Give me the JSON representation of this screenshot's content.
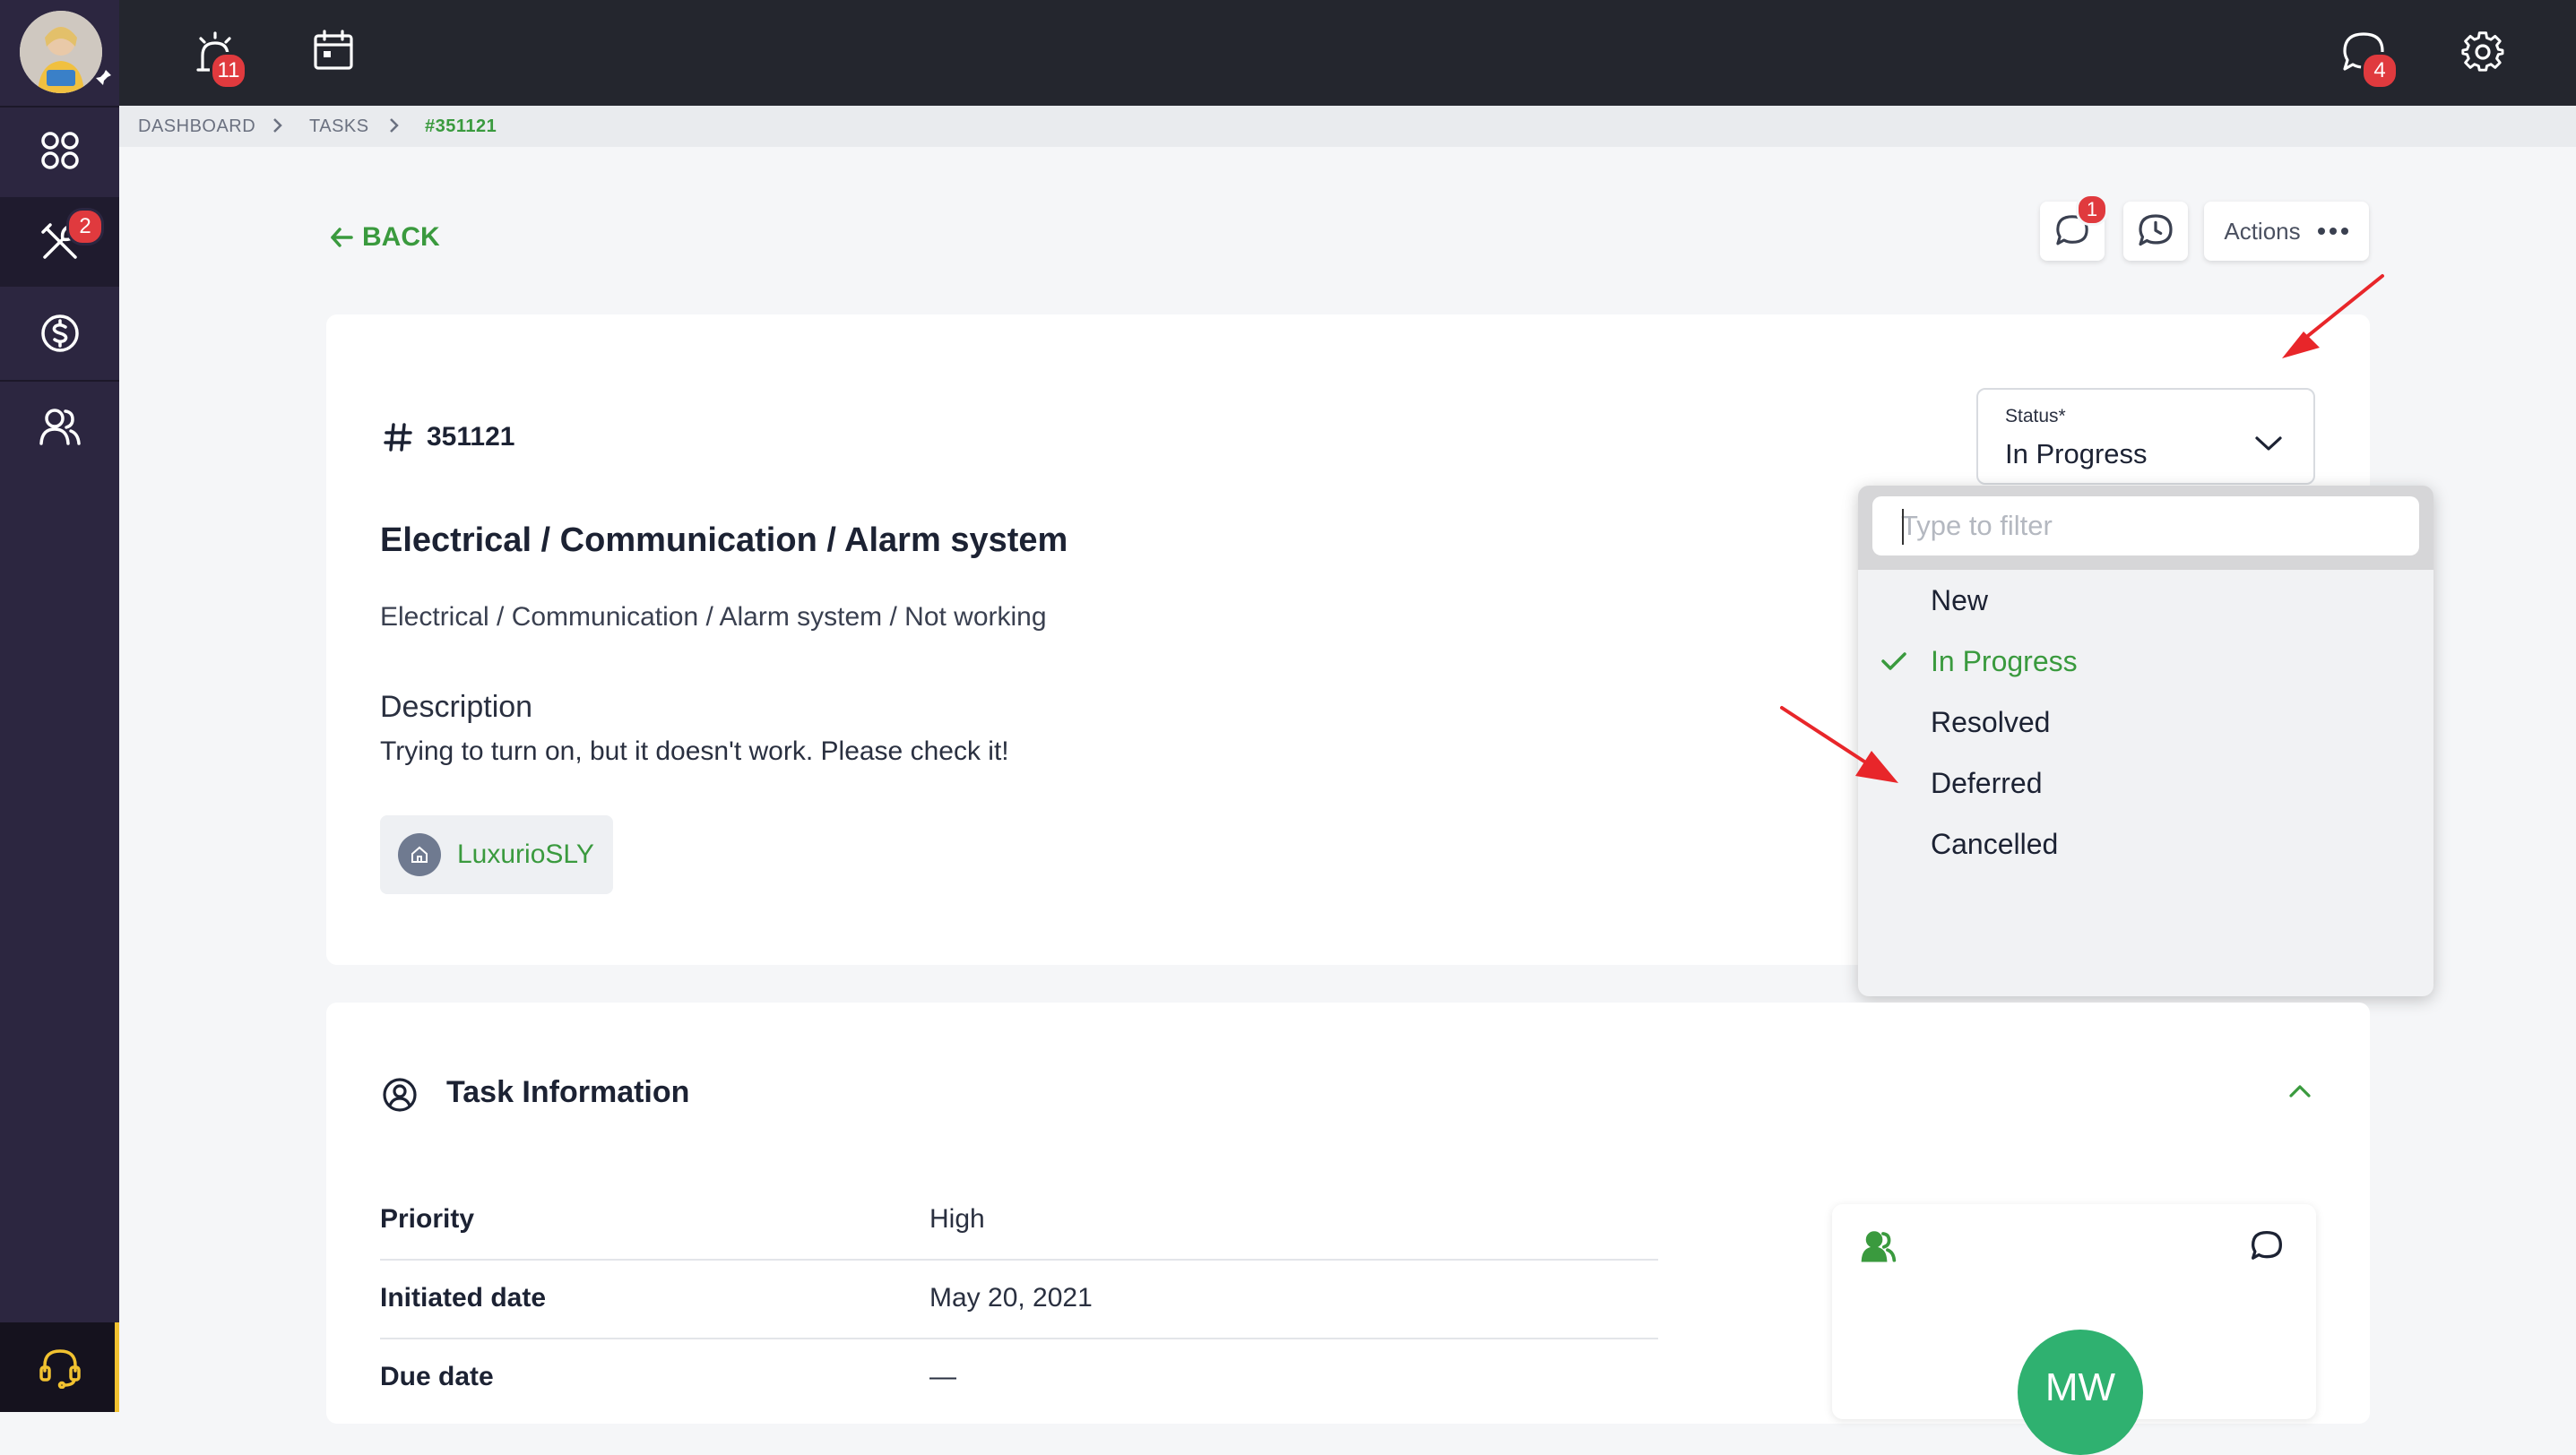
{
  "nav": {
    "alarms_badge": "11",
    "tools_badge": "2",
    "messages_badge": "4"
  },
  "breadcrumb": {
    "items": [
      "DASHBOARD",
      "TASKS",
      "#351121"
    ]
  },
  "toolbar": {
    "back_label": "BACK",
    "comments_badge": "1",
    "actions_label": "Actions"
  },
  "task": {
    "id": "351121",
    "title": "Electrical / Communication / Alarm system",
    "path": "Electrical / Communication / Alarm system / Not working",
    "description_label": "Description",
    "description": "Trying to turn on, but it doesn't work. Please check it!",
    "property": "LuxurioSLY"
  },
  "status": {
    "label": "Status*",
    "value": "In Progress",
    "filter_placeholder": "Type to filter",
    "options": [
      {
        "label": "New",
        "selected": false
      },
      {
        "label": "In Progress",
        "selected": true
      },
      {
        "label": "Resolved",
        "selected": false
      },
      {
        "label": "Deferred",
        "selected": false
      },
      {
        "label": "Cancelled",
        "selected": false
      }
    ]
  },
  "task_info": {
    "title": "Task Information",
    "rows": [
      {
        "label": "Priority",
        "value": "High"
      },
      {
        "label": "Initiated date",
        "value": "May 20, 2021"
      },
      {
        "label": "Due date",
        "value": "—"
      }
    ]
  },
  "assignee": {
    "initials": "MW"
  },
  "colors": {
    "accent_green": "#3a9a3e",
    "sidebar": "#2c2640",
    "topbar": "#24262e",
    "badge_red": "#e03a3e",
    "annotation_arrow": "#e8262a"
  }
}
